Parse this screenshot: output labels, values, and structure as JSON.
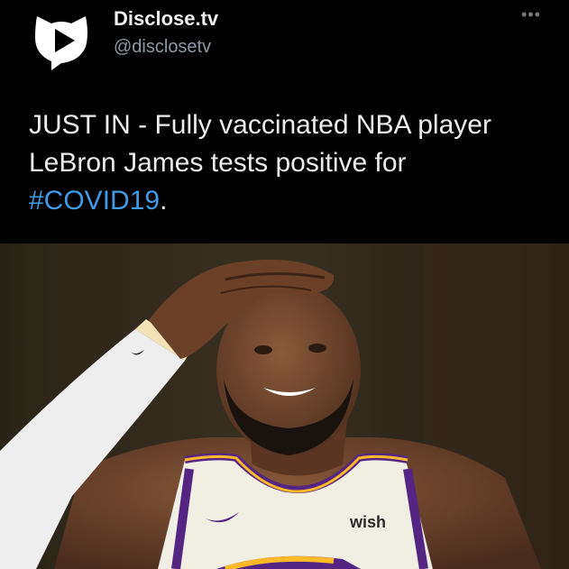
{
  "account": {
    "display_name": "Disclose.tv",
    "handle": "@disclosetv",
    "avatar_icon": "disclose-play-logo-icon",
    "more_icon": "more-options-icon"
  },
  "tweet": {
    "text_before": "JUST IN - Fully vaccinated NBA player LeBron James tests positive for ",
    "hashtag": "#COVID19",
    "text_after": "."
  },
  "photo": {
    "jersey_text": "wish"
  },
  "colors": {
    "background": "#000000",
    "hashtag": "#3f9be8",
    "jersey_purple": "#552583",
    "jersey_gold": "#fdb927"
  }
}
